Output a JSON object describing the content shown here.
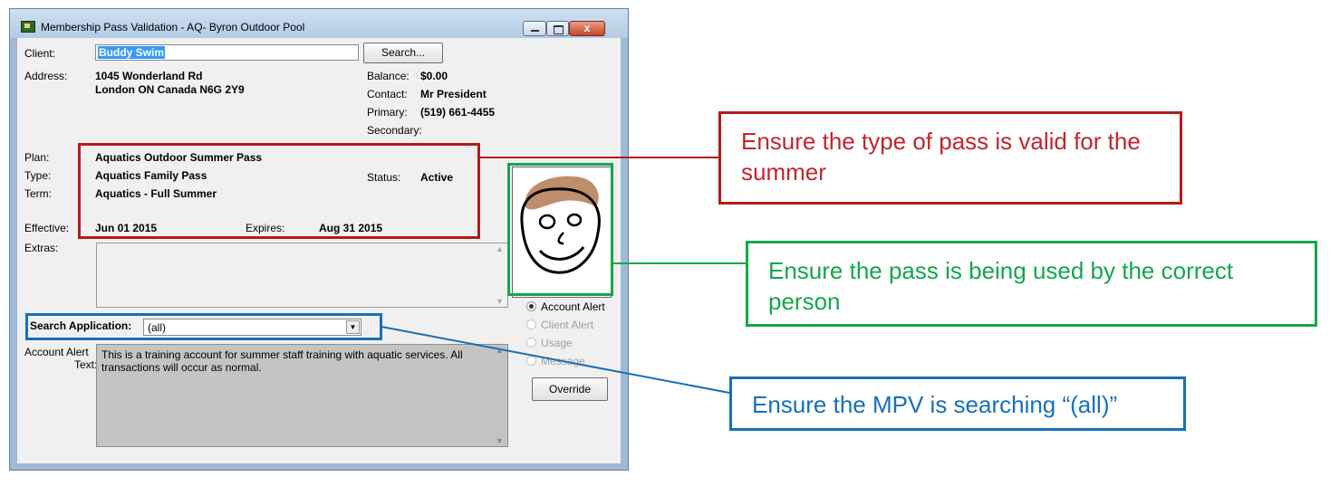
{
  "window": {
    "title": "Membership Pass Validation - AQ- Byron Outdoor Pool",
    "close_glyph": "x"
  },
  "client": {
    "label": "Client:",
    "value": "Buddy Swim",
    "search_button": "Search..."
  },
  "address": {
    "label": "Address:",
    "line1": "1045 Wonderland Rd",
    "line2": "London ON Canada  N6G 2Y9"
  },
  "contact_info": {
    "balance_label": "Balance:",
    "balance_value": "$0.00",
    "contact_label": "Contact:",
    "contact_value": "Mr President",
    "primary_label": "Primary:",
    "primary_value": "(519) 661-4455",
    "secondary_label": "Secondary:"
  },
  "pass": {
    "plan_label": "Plan:",
    "plan_value": "Aquatics Outdoor Summer Pass",
    "type_label": "Type:",
    "type_value": "Aquatics Family Pass",
    "term_label": "Term:",
    "term_value": "Aquatics - Full Summer",
    "status_label": "Status:",
    "status_value": "Active",
    "effective_label": "Effective:",
    "effective_value": "Jun 01 2015",
    "expires_label": "Expires:",
    "expires_value": "Aug 31 2015",
    "extras_label": "Extras:"
  },
  "search_app": {
    "label": "Search Application:",
    "value": "(all)"
  },
  "alert": {
    "label_line1": "Account Alert",
    "label_line2": "Text:",
    "text": "This is a training account for summer staff training with aquatic services.  All transactions will occur as normal."
  },
  "radios": [
    {
      "label": "Account Alert",
      "selected": true,
      "enabled": true
    },
    {
      "label": "Client Alert",
      "selected": false,
      "enabled": false
    },
    {
      "label": "Usage",
      "selected": false,
      "enabled": false
    },
    {
      "label": "Message",
      "selected": false,
      "enabled": false
    }
  ],
  "override_button": "Override",
  "callouts": {
    "red": "Ensure the type of pass is valid for the summer",
    "green": "Ensure the pass is being used by the correct person",
    "blue": "Ensure the MPV is searching “(all)”"
  },
  "colors": {
    "red": "#b31b1b",
    "green": "#13a84a",
    "blue": "#1770b9",
    "callout_red_text": "#c0262d"
  }
}
